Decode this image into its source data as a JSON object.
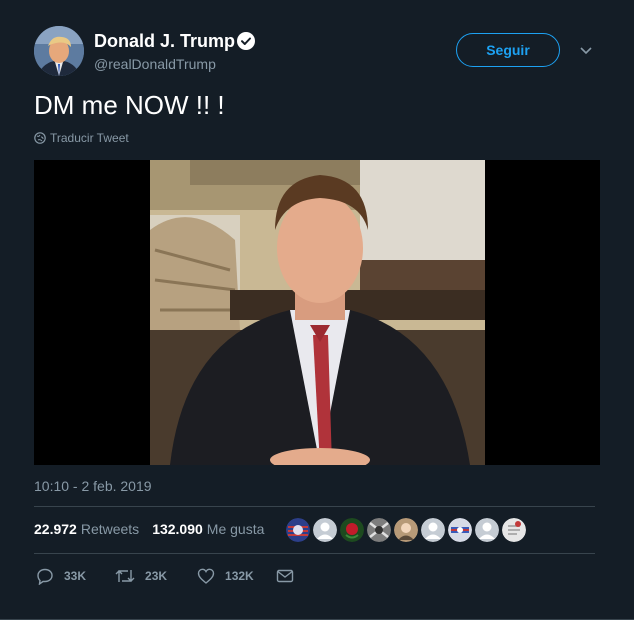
{
  "header": {
    "name": "Donald J. Trump",
    "handle": "@realDonaldTrump",
    "follow_label": "Seguir"
  },
  "tweet": {
    "text": "DM me NOW !! !",
    "translate_label": "Traducir Tweet",
    "timestamp": "10:10 - 2 feb. 2019"
  },
  "stats": {
    "retweets_count": "22.972",
    "retweets_label": "Retweets",
    "likes_count": "132.090",
    "likes_label": "Me gusta"
  },
  "actions": {
    "replies": "33K",
    "retweets": "23K",
    "likes": "132K"
  },
  "icons": [
    "verified-icon",
    "chevron-down-icon",
    "globe-icon",
    "reply-icon",
    "retweet-icon",
    "heart-icon",
    "dm-icon"
  ],
  "colors": {
    "background": "#141d26",
    "accent": "#1da1f2",
    "secondary_text": "#8899a6",
    "divider": "#38444d"
  }
}
